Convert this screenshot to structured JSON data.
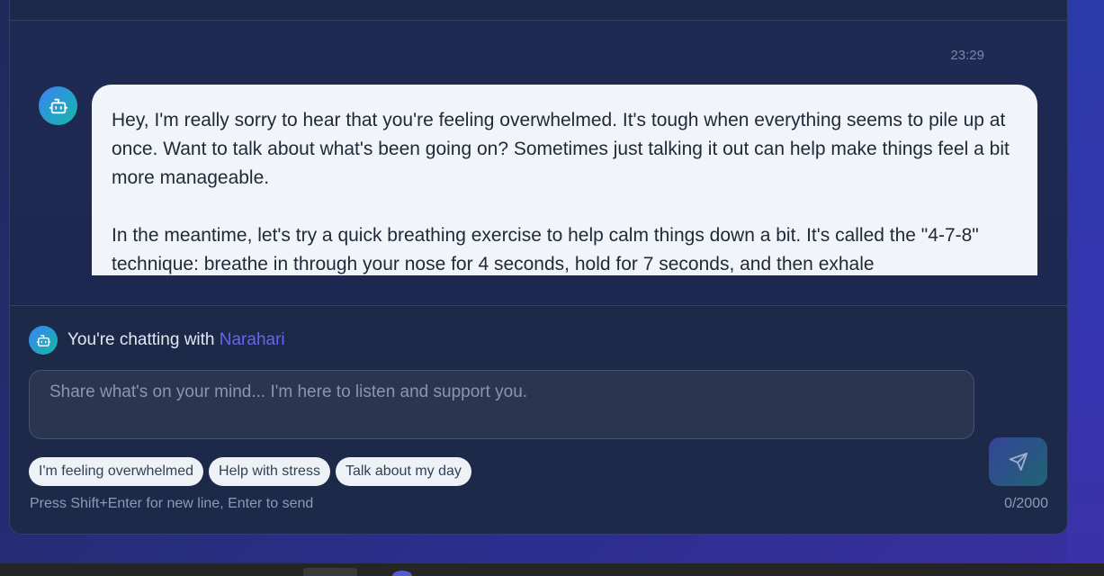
{
  "chat": {
    "timestamp": "23:29",
    "assistant_message": "Hey, I'm really sorry to hear that you're feeling overwhelmed. It's tough when everything seems to pile up at once. Want to talk about what's been going on? Sometimes just talking it out can help make things feel a bit more manageable.\n\nIn the meantime, let's try a quick breathing exercise to help calm things down a bit. It's called the \"4-7-8\" technique: breathe in through your nose for 4 seconds, hold for 7 seconds, and then exhale"
  },
  "composer": {
    "chatting_with_prefix": "You're chatting with",
    "bot_name": "Narahari",
    "input_placeholder": "Share what's on your mind... I'm here to listen and support you.",
    "input_value": "",
    "quick_replies": [
      "I'm feeling overwhelmed",
      "Help with stress",
      "Talk about my day"
    ],
    "hint": "Press Shift+Enter for new line, Enter to send",
    "char_count": "0/2000"
  },
  "icons": {
    "avatar": "robot-icon",
    "send": "send-icon"
  },
  "colors": {
    "accent": "#6366f1",
    "avatar_gradient_start": "#3b82f6",
    "avatar_gradient_end": "#14b8a6",
    "bubble_bg": "#f1f5f9"
  }
}
